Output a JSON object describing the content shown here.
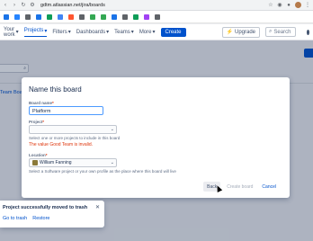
{
  "browser": {
    "url": "gdtm.atlassian.net/jira/boards",
    "bookmarks": [
      {
        "label": "",
        "color": "#1a73e8"
      },
      {
        "label": "",
        "color": "#2684ff"
      },
      {
        "label": "",
        "color": "#5f6368"
      },
      {
        "label": "",
        "color": "#1a73e8"
      },
      {
        "label": "",
        "color": "#0f9d58"
      },
      {
        "label": "",
        "color": "#4285f4"
      },
      {
        "label": "",
        "color": "#ff5630"
      },
      {
        "label": "",
        "color": "#5f6368"
      },
      {
        "label": "",
        "color": "#34a853"
      },
      {
        "label": "",
        "color": "#34a853"
      },
      {
        "label": "",
        "color": "#1a73e8"
      },
      {
        "label": "",
        "color": "#5f6368"
      },
      {
        "label": "",
        "color": "#0f9d58"
      },
      {
        "label": "",
        "color": "#a142f4"
      },
      {
        "label": "",
        "color": "#5f6368"
      }
    ]
  },
  "nav": {
    "your_work": "Your work",
    "projects": "Projects",
    "filters": "Filters",
    "dashboards": "Dashboards",
    "teams": "Teams",
    "more": "More",
    "create": "Create",
    "upgrade": "Upgrade",
    "search_placeholder": "Search"
  },
  "background": {
    "team_board_link": "Team Board"
  },
  "modal": {
    "title": "Name this board",
    "board_name_label": "Board name",
    "board_name_value": "Platform",
    "project_label": "Project",
    "project_value": "",
    "project_help": "Select one or more projects to include in this board",
    "project_error": "The value Good Team is invalid.",
    "location_label": "Location",
    "location_value": "William Fanning",
    "location_help": "Select a Software project or your own profile as the place where this board will live",
    "back": "Back",
    "create_board": "Create board",
    "cancel": "Cancel"
  },
  "toast": {
    "message": "Project successfully moved to trash",
    "go_to_trash": "Go to trash",
    "restore": "Restore"
  },
  "colors": {
    "brand": "#0052cc",
    "error": "#de350b"
  }
}
